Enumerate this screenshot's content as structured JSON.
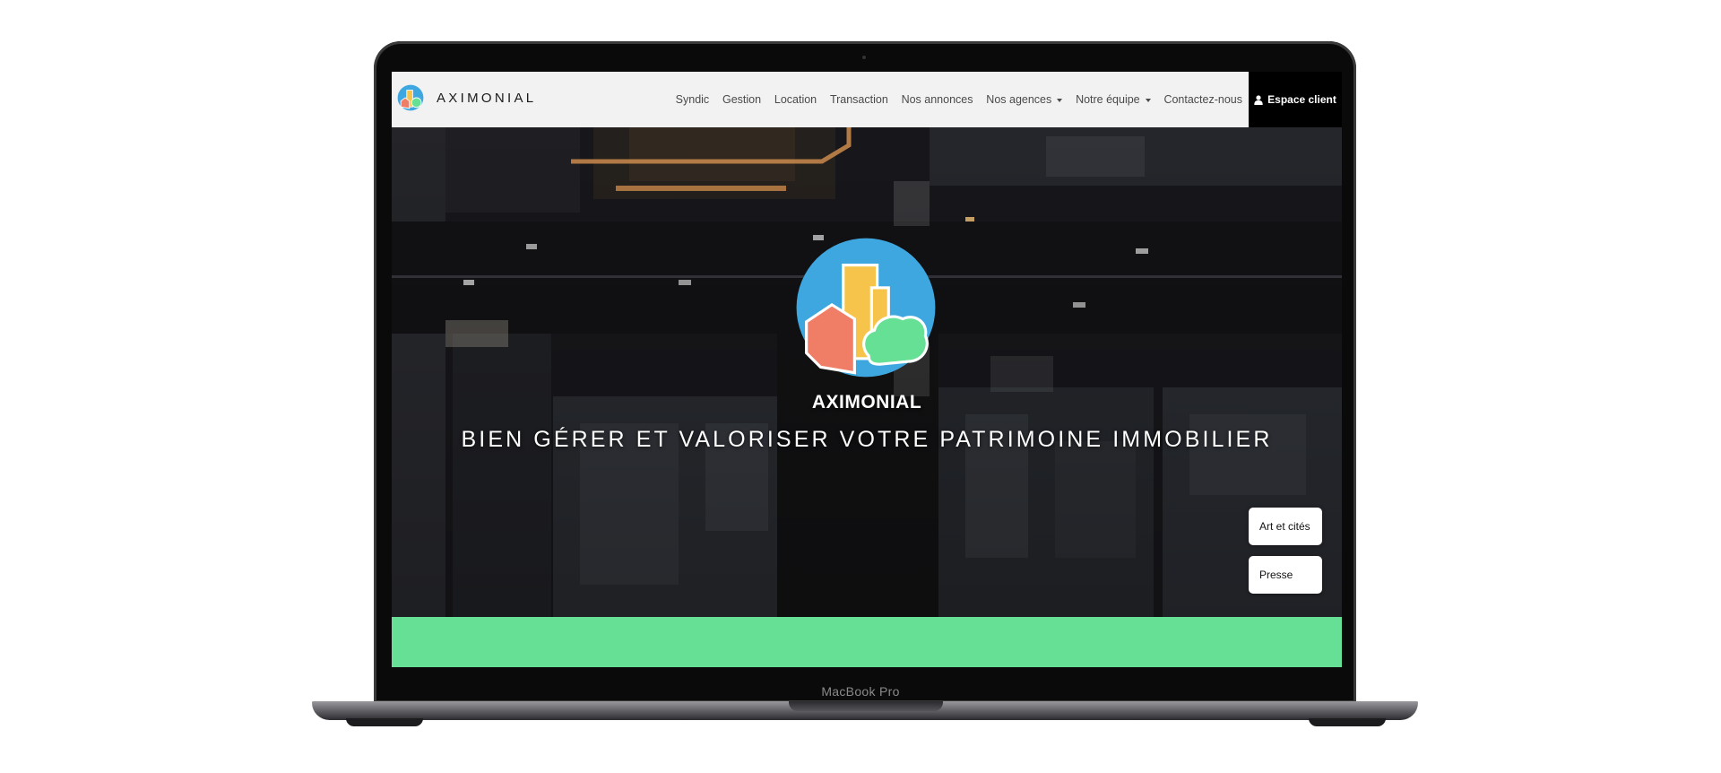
{
  "device": {
    "label": "MacBook Pro"
  },
  "nav": {
    "brand": "AXIMONIAL",
    "items": [
      {
        "label": "Syndic"
      },
      {
        "label": "Gestion"
      },
      {
        "label": "Location"
      },
      {
        "label": "Transaction"
      },
      {
        "label": "Nos annonces"
      },
      {
        "label": "Nos agences"
      },
      {
        "label": "Notre équipe"
      },
      {
        "label": "Contactez-nous"
      }
    ],
    "client_button": "Espace client",
    "client_icon": "user-icon"
  },
  "hero": {
    "brand": "AXIMONIAL",
    "tagline": "BIEN GÉRER ET VALORISER VOTRE PATRIMOINE IMMOBILIER",
    "side_buttons": [
      {
        "label": "Art et cités"
      },
      {
        "label": "Presse"
      }
    ]
  },
  "colors": {
    "logo_blue": "#3ea7e0",
    "logo_yellow": "#f7c44b",
    "logo_red": "#f07d66",
    "logo_green": "#66e094",
    "band_green": "#66e094",
    "nav_bg": "#f2f2f2",
    "client_bg": "#000000"
  }
}
